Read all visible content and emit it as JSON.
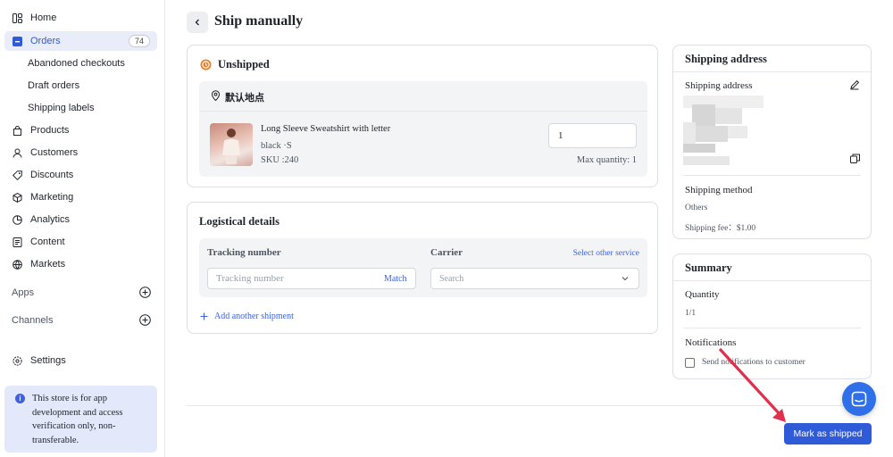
{
  "sidebar": {
    "items": [
      {
        "label": "Home",
        "icon": "home-icon"
      },
      {
        "label": "Orders",
        "icon": "orders-icon",
        "badge": "74",
        "active": true
      },
      {
        "label": "Abandoned checkouts"
      },
      {
        "label": "Draft orders"
      },
      {
        "label": "Shipping labels"
      },
      {
        "label": "Products",
        "icon": "bag-icon"
      },
      {
        "label": "Customers",
        "icon": "person-icon"
      },
      {
        "label": "Discounts",
        "icon": "tag-icon"
      },
      {
        "label": "Marketing",
        "icon": "cube-icon"
      },
      {
        "label": "Analytics",
        "icon": "pie-icon"
      },
      {
        "label": "Content",
        "icon": "document-icon"
      },
      {
        "label": "Markets",
        "icon": "globe-icon"
      }
    ],
    "apps_label": "Apps",
    "channels_label": "Channels",
    "settings_label": "Settings",
    "notice": "This store is for app development and access verification only, non-transferable."
  },
  "header": {
    "title": "Ship manually"
  },
  "unshipped_card": {
    "status": "Unshipped",
    "location": "默认地点",
    "product_name": "Long Sleeve Sweatshirt with letter",
    "variant": "black ·S",
    "sku": "SKU :240",
    "quantity_value": "1",
    "max_quantity": "Max quantity: 1"
  },
  "logistics_card": {
    "title": "Logistical details",
    "tracking_label": "Tracking number",
    "tracking_placeholder": "Tracking number",
    "match_label": "Match",
    "carrier_label": "Carrier",
    "select_other": "Select other service",
    "carrier_placeholder": "Search",
    "add_shipment": "Add another shipment"
  },
  "address_card": {
    "title": "Shipping address",
    "subtitle": "Shipping address",
    "method_label": "Shipping method",
    "method_value": "Others",
    "fee": "Shipping fee：$1.00"
  },
  "summary_card": {
    "title": "Summary",
    "quantity_label": "Quantity",
    "quantity_value": "1/1",
    "notifications_label": "Notifications",
    "send_label": "Send notifications to customer"
  },
  "footer": {
    "mark_shipped": "Mark as shipped"
  },
  "colors": {
    "accent": "#2f5bd8",
    "link": "#3b62e0",
    "unshipped": "#e8802a",
    "arrow": "#e0304e"
  }
}
